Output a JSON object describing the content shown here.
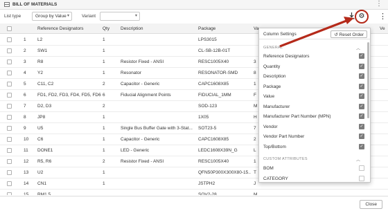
{
  "window": {
    "title": "BILL OF MATERIALS",
    "menu_icon": "vertical-dots-icon"
  },
  "toolbar": {
    "list_type_label": "List type",
    "list_type_value": "Group by Value",
    "variant_label": "Variant",
    "variant_value": "",
    "download_icon": "download-icon",
    "settings_icon": "gear-icon",
    "more_icon": "vertical-dots-icon"
  },
  "table": {
    "columns": [
      "",
      "Reference Designators",
      "Qty",
      "Description",
      "Package",
      "Va",
      "Ve"
    ],
    "rows": [
      {
        "num": "1",
        "ref": "L2",
        "qty": "1",
        "desc": "",
        "pkg": "LPS3015",
        "val": ""
      },
      {
        "num": "2",
        "ref": "SW1",
        "qty": "1",
        "desc": "",
        "pkg": "CL-SB-12B-01T",
        "val": ""
      },
      {
        "num": "3",
        "ref": "R8",
        "qty": "1",
        "desc": "Resistor Fixed - ANSI",
        "pkg": "RESC1005X40",
        "val": "3"
      },
      {
        "num": "4",
        "ref": "Y2",
        "qty": "1",
        "desc": "Resonator",
        "pkg": "RESONATOR-SMD",
        "val": "8"
      },
      {
        "num": "5",
        "ref": "C11, C2",
        "qty": "2",
        "desc": "Capacitor - Generic",
        "pkg": "CAPC1608X85",
        "val": "1"
      },
      {
        "num": "6",
        "ref": "FD1, FD2, FD3, FD4, FD5, FD6",
        "qty": "6",
        "desc": "Fiducial Alignment Points",
        "pkg": "FIDUCIAL_1MM",
        "val": "F"
      },
      {
        "num": "7",
        "ref": "D2, D3",
        "qty": "2",
        "desc": "",
        "pkg": "SOD-123",
        "val": "M"
      },
      {
        "num": "8",
        "ref": "JP8",
        "qty": "1",
        "desc": "",
        "pkg": "1X05",
        "val": "H"
      },
      {
        "num": "9",
        "ref": "U5",
        "qty": "1",
        "desc": "Single Bus Buffer Gate with 3-Stat...",
        "pkg": "SOT23-5",
        "val": "7"
      },
      {
        "num": "10",
        "ref": "C6",
        "qty": "1",
        "desc": "Capacitor - Generic",
        "pkg": "CAPC1608X85",
        "val": "2"
      },
      {
        "num": "11",
        "ref": "DONE1",
        "qty": "1",
        "desc": "LED - Generic",
        "pkg": "LEDC1608X39N_G",
        "val": "L"
      },
      {
        "num": "12",
        "ref": "R5, R6",
        "qty": "2",
        "desc": "Resistor Fixed - ANSI",
        "pkg": "RESC1005X40",
        "val": "1"
      },
      {
        "num": "13",
        "ref": "U2",
        "qty": "1",
        "desc": "",
        "pkg": "QFN50P300X300X80-15...",
        "val": "T"
      },
      {
        "num": "14",
        "ref": "CN1",
        "qty": "1",
        "desc": "",
        "pkg": "JSTPH2",
        "val": "J"
      },
      {
        "num": "15",
        "ref": "RM1 5",
        "qty": "",
        "desc": "",
        "pkg": "SOV2-28",
        "val": "M"
      }
    ]
  },
  "column_settings": {
    "title": "Column Settings",
    "reset_label": "Reset Order",
    "reset_icon": "undo-icon",
    "general_label": "GENERAL",
    "general_items": [
      {
        "label": "Reference Designators",
        "checked": true
      },
      {
        "label": "Quantity",
        "checked": true
      },
      {
        "label": "Description",
        "checked": true
      },
      {
        "label": "Package",
        "checked": true
      },
      {
        "label": "Value",
        "checked": true
      },
      {
        "label": "Manufacturer",
        "checked": true
      },
      {
        "label": "Manufacturer Part Number (MPN)",
        "checked": true
      },
      {
        "label": "Vendor",
        "checked": true
      },
      {
        "label": "Vendor Part Number",
        "checked": true
      },
      {
        "label": "Top/Bottom",
        "checked": true
      }
    ],
    "custom_label": "CUSTOM ATTRIBUTES",
    "custom_items": [
      {
        "label": "BOM",
        "checked": false
      },
      {
        "label": "CATEGORY",
        "checked": false
      }
    ]
  },
  "annotation": {
    "highlight_color": "#b52a1a"
  },
  "footer": {
    "close_label": "Close"
  }
}
